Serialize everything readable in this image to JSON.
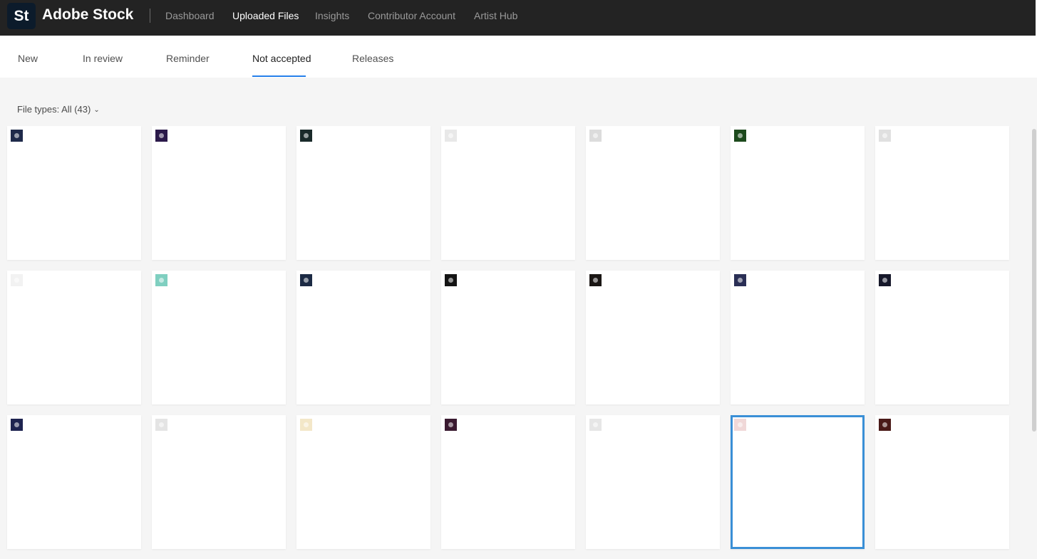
{
  "app": {
    "logo_text": "St",
    "brand": "Adobe Stock"
  },
  "topnav": [
    {
      "label": "Dashboard",
      "active": false
    },
    {
      "label": "Uploaded Files",
      "active": true
    },
    {
      "label": "Insights",
      "active": false
    },
    {
      "label": "Contributor Account",
      "active": false
    },
    {
      "label": "Artist Hub",
      "active": false
    }
  ],
  "subtabs": [
    {
      "label": "New",
      "active": false
    },
    {
      "label": "In review",
      "active": false
    },
    {
      "label": "Reminder",
      "active": false
    },
    {
      "label": "Not accepted",
      "active": true
    },
    {
      "label": "Releases",
      "active": false
    }
  ],
  "filter": {
    "label": "File types: All (43)"
  },
  "tiles": [
    {
      "thumb": "astronaut-dark",
      "color": "#1f2a4a",
      "selected": false
    },
    {
      "thumb": "purple-character",
      "color": "#2b1a4a",
      "selected": false
    },
    {
      "thumb": "green-character-dark",
      "color": "#1a2a2a",
      "selected": false
    },
    {
      "thumb": "sketch-figures",
      "color": "#e8e8e8",
      "selected": false
    },
    {
      "thumb": "sketch-dancers",
      "color": "#dcdcdc",
      "selected": false
    },
    {
      "thumb": "green-emblem",
      "color": "#1d4a1d",
      "selected": false
    },
    {
      "thumb": "sketch-birds",
      "color": "#e0e0e0",
      "selected": false
    },
    {
      "thumb": "light-sketch",
      "color": "#f2f2f2",
      "selected": false
    },
    {
      "thumb": "teal-pattern",
      "color": "#7fcfc0",
      "selected": false
    },
    {
      "thumb": "blue-emblem-dark",
      "color": "#1c2a44",
      "selected": false
    },
    {
      "thumb": "orange-flower-dark",
      "color": "#141414",
      "selected": false
    },
    {
      "thumb": "gold-ornament-dark",
      "color": "#1a1614",
      "selected": false
    },
    {
      "thumb": "astronaut-portrait",
      "color": "#2a2f55",
      "selected": false
    },
    {
      "thumb": "colorful-bouquet-dark",
      "color": "#16182a",
      "selected": false
    },
    {
      "thumb": "astronaut-navy",
      "color": "#1e2450",
      "selected": false
    },
    {
      "thumb": "sketch-grid",
      "color": "#e4e4e4",
      "selected": false
    },
    {
      "thumb": "colorful-character",
      "color": "#f3e7c8",
      "selected": false
    },
    {
      "thumb": "pink-character-dark",
      "color": "#3a1a30",
      "selected": false
    },
    {
      "thumb": "sketch-pair",
      "color": "#e6e6e6",
      "selected": false
    },
    {
      "thumb": "red-lips",
      "color": "#f0d8d8",
      "selected": true
    },
    {
      "thumb": "brown-animal-face",
      "color": "#4a1a18",
      "selected": false
    }
  ]
}
